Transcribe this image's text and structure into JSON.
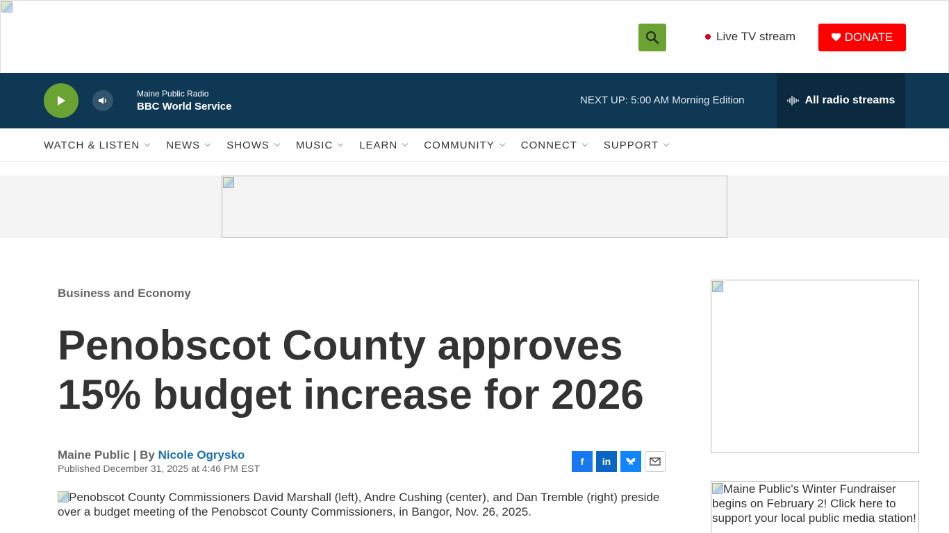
{
  "header": {
    "live_tv_label": "Live TV stream",
    "donate_label": "DONATE"
  },
  "player": {
    "station_sub": "Maine Public Radio",
    "station_main": "BBC World Service",
    "next_up": "NEXT UP: 5:00 AM Morning Edition",
    "all_streams_label": "All radio streams"
  },
  "nav": {
    "items": [
      {
        "label": "WATCH & LISTEN"
      },
      {
        "label": "NEWS"
      },
      {
        "label": "SHOWS"
      },
      {
        "label": "MUSIC"
      },
      {
        "label": "LEARN"
      },
      {
        "label": "COMMUNITY"
      },
      {
        "label": "CONNECT"
      },
      {
        "label": "SUPPORT"
      }
    ]
  },
  "article": {
    "category": "Business and Economy",
    "headline": "Penobscot County approves 15% budget increase for 2026",
    "source": "Maine Public | By ",
    "author": "Nicole Ogrysko",
    "published": "Published December 31, 2025 at 4:46 PM EST",
    "photo_alt": "Penobscot County Commissioners David Marshall (left), Andre Cushing (center), and Dan Tremble (right) preside over a budget meeting of the Penobscot County Commissioners, in Bangor, Nov. 26, 2025."
  },
  "share": {
    "facebook": "f",
    "linkedin": "in"
  },
  "sidebar": {
    "promo_alt": "Maine Public's Winter Fundraiser begins on February 2! Click here to support your local public media station!"
  },
  "colors": {
    "accent_green": "#6aa332",
    "player_bg": "#0f3854",
    "donate_red": "#ff0000",
    "author_link": "#1a6fb0"
  }
}
